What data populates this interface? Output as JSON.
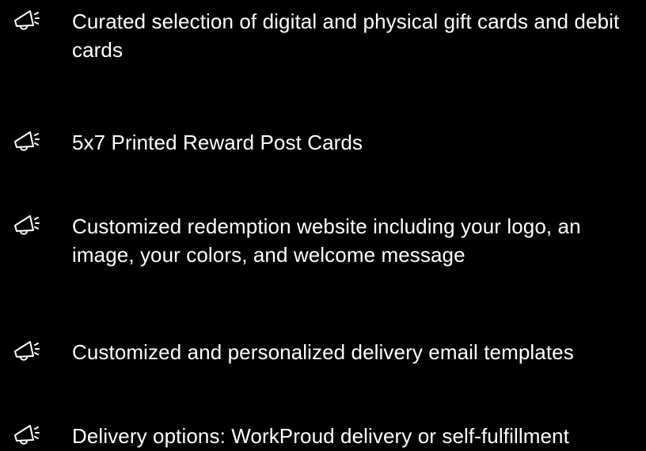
{
  "theme": {
    "background": "#000000",
    "text_color": "#ffffff",
    "icon_color": "#ffffff"
  },
  "features": [
    {
      "icon": "megaphone-icon",
      "text": "Curated selection of digital and physical gift cards and debit cards"
    },
    {
      "icon": "megaphone-icon",
      "text": "5x7 Printed Reward Post Cards"
    },
    {
      "icon": "megaphone-icon",
      "text": "Customized redemption website including your logo, an image, your colors, and welcome message"
    },
    {
      "icon": "megaphone-icon",
      "text": "Customized and personalized delivery email templates"
    },
    {
      "icon": "megaphone-icon",
      "text": "Delivery options: WorkProud delivery or self-fulfillment"
    }
  ]
}
